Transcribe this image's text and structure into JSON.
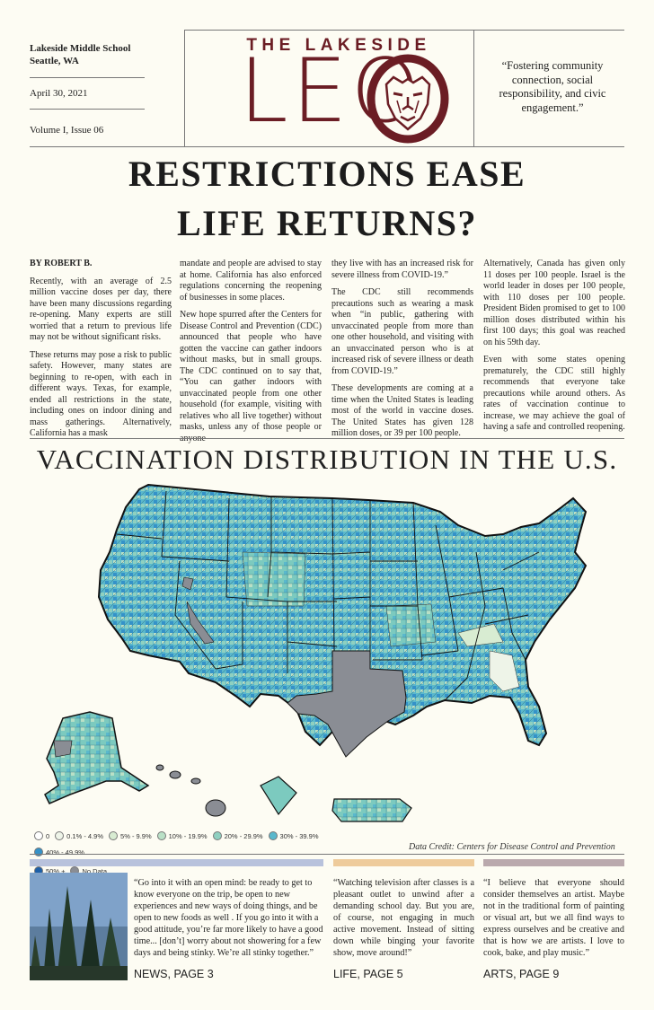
{
  "masthead": {
    "school": "Lakeside Middle School",
    "location": "Seattle, WA",
    "date": "April 30, 2021",
    "issue": "Volume I, Issue 06",
    "title_top": "THE LAKESIDE",
    "title_main": "LEO",
    "motto": "“Fostering community connection, social responsibility, and civic engagement.”"
  },
  "headline": {
    "line1": "RESTRICTIONS EASE",
    "line2": "LIFE RETURNS?"
  },
  "article": {
    "byline": "BY ROBERT B.",
    "col1": [
      "Recently, with an average of 2.5 million vaccine doses per day, there have been many discussions regarding re-opening. Many experts are still worried that a return to previous life may not be without significant risks.",
      "These returns may pose a risk to public safety. However, many states are beginning to re-open, with each in different ways. Texas, for example, ended all restrictions in the state, including ones on indoor dining and mass gatherings. Alternatively, California has a mask"
    ],
    "col2": [
      "mandate and people are advised to stay at home. California has also enforced regulations concerning the reopening of businesses in some places.",
      "New hope spurred after the Centers for Disease Control and Prevention (CDC) announced that people who have gotten the vaccine can gather indoors without masks, but in small groups. The CDC continued on to say that, “You can gather indoors with unvaccinated people from one other household (for example, visiting with relatives who all live together) without masks, unless any of those people or anyone"
    ],
    "col3": [
      "they live with has an increased risk for severe illness from COVID-19.”",
      "The CDC still recommends precautions such as wearing a mask when “in public, gathering with unvaccinated people from more than one other household, and visiting with an unvaccinated person who is at increased risk of severe illness or death from COVID-19.”",
      "These developments are coming at a time when the United States is leading most of the world in vaccine doses. The United States has given 128 million doses, or 39 per 100 people."
    ],
    "col4": [
      "Alternatively, Canada has given only 11 doses per 100 people. Israel is the world leader in doses per 100 people, with 110 doses per 100 people. President Biden promised to get to 100 million doses distributed within his first 100 days; this goal was reached on his 59th day.",
      "Even with some states opening prematurely, the CDC still highly recommends that everyone take precautions while around others. As rates of vaccination continue to increase, we may achieve the goal of having a safe and controlled reopening."
    ]
  },
  "map": {
    "title": "VACCINATION DISTRIBUTION IN THE U.S.",
    "credit": "Data Credit: Centers for Disease Control and Prevention",
    "legend": [
      {
        "label": "0",
        "color": "#ffffff"
      },
      {
        "label": "0.1% - 4.9%",
        "color": "#eef4e8"
      },
      {
        "label": "5% - 9.9%",
        "color": "#d8ecd2"
      },
      {
        "label": "10% - 19.9%",
        "color": "#b9e0c6"
      },
      {
        "label": "20% - 29.9%",
        "color": "#8fd0c0"
      },
      {
        "label": "30% - 39.9%",
        "color": "#5ab8cc"
      },
      {
        "label": "40% - 49.9%",
        "color": "#3592c8"
      },
      {
        "label": "50% +",
        "color": "#1d5fa7"
      },
      {
        "label": "No Data",
        "color": "#8a8d94"
      }
    ]
  },
  "footer": {
    "bar_colors": [
      "#b8c2dc",
      "#eecb9b",
      "#baa9ad"
    ],
    "news_quote": "“Go into it with an open mind: be ready to get to know everyone on the trip, be open to new experiences and new ways of doing things, and be open to new foods as well . If you go into it with a good attitude, you’re far more likely to have a good time... [don’t] worry about not showering for a few days and being stinky. We’re all stinky together.”",
    "news_label": "NEWS, PAGE 3",
    "life_quote": "“Watching television after classes is a pleasant outlet to unwind after a demanding school day. But you are, of course, not engaging in much active movement. Instead of sitting down while binging your favorite show, move around!”",
    "life_label": "LIFE, PAGE 5",
    "arts_quote": "“I believe that everyone should consider themselves an artist. Maybe not in the traditional form of painting or visual art, but we all find ways to express ourselves and be creative and that is how we are artists. I love to cook, bake, and play music.”",
    "arts_label": "ARTS, PAGE 9"
  }
}
